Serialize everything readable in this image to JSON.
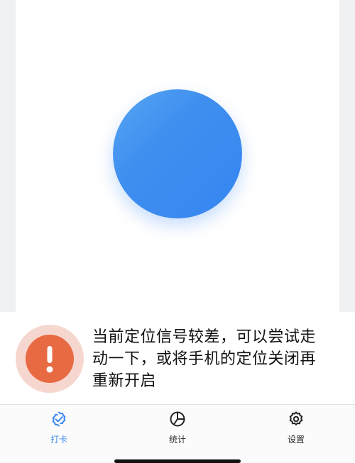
{
  "punch": {
    "accent_color": "#3585f1"
  },
  "warning": {
    "icon": "exclamation-icon",
    "icon_color": "#e86a43",
    "message": "当前定位信号较差，可以尝试走动一下，或将手机的定位关闭再重新开启"
  },
  "tabbar": {
    "active_color": "#3a86ee",
    "tabs": [
      {
        "label": "打卡",
        "icon": "check-badge-icon",
        "active": true
      },
      {
        "label": "统计",
        "icon": "pie-chart-icon",
        "active": false
      },
      {
        "label": "设置",
        "icon": "gear-icon",
        "active": false
      }
    ]
  }
}
